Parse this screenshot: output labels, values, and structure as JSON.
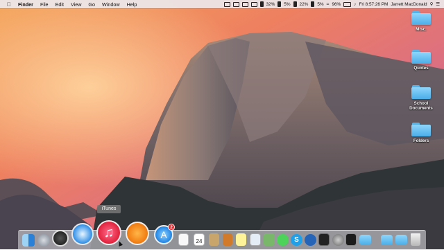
{
  "menubar": {
    "apple_icon": "apple-logo-icon",
    "items": [
      "Finder",
      "File",
      "Edit",
      "View",
      "Go",
      "Window",
      "Help"
    ],
    "status": {
      "cpu1": "32%",
      "cpu2": "5%",
      "cpu3": "22%",
      "cpu4": "5%",
      "battery": "96%",
      "clock": "Fri 8:57:26 PM",
      "user": "Jarrett MacDonald"
    }
  },
  "desktop": {
    "folders": [
      {
        "label": "Misc."
      },
      {
        "label": "Quotes"
      },
      {
        "label": "School Documents"
      },
      {
        "label": "Folders"
      }
    ],
    "folder_color": "#4aaee8"
  },
  "tooltip": {
    "text": "iTunes"
  },
  "dock": {
    "calendar_day": "24",
    "appstore_badge": "2",
    "icons": [
      "finder-icon",
      "launchpad-icon",
      "dashboard-icon",
      "safari-icon",
      "itunes-icon",
      "ibooks-icon",
      "app-store-icon",
      "textedit-icon",
      "calendar-icon",
      "notes-icon",
      "stickies-icon",
      "preview-icon",
      "photos-icon",
      "messages-icon",
      "skype-icon",
      "quicktime-icon",
      "activity-monitor-icon",
      "system-preferences-icon",
      "terminal-icon",
      "folder-icon",
      "folder-icon",
      "folder-icon",
      "trash-icon"
    ]
  }
}
